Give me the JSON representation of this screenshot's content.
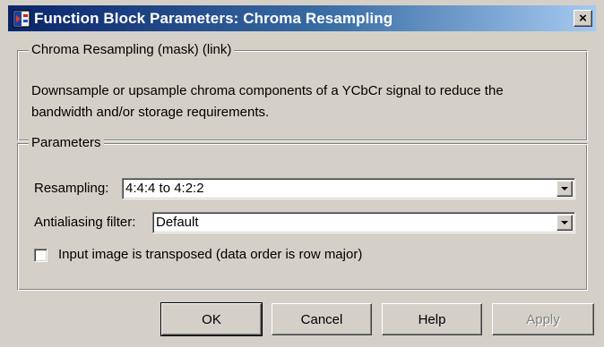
{
  "window": {
    "title": "Function Block Parameters: Chroma Resampling",
    "close_glyph": "×"
  },
  "description_group": {
    "legend": "Chroma Resampling (mask) (link)",
    "lines": [
      "Downsample or upsample chroma components of a YCbCr signal to reduce the",
      "bandwidth and/or storage requirements."
    ]
  },
  "parameters_group": {
    "legend": "Parameters",
    "resampling": {
      "label": "Resampling:",
      "value": "4:4:4 to 4:2:2"
    },
    "antialiasing": {
      "label": "Antialiasing filter:",
      "value": "Default"
    },
    "transposed": {
      "label": "Input image is transposed (data order is row major)",
      "checked": false
    }
  },
  "buttons": {
    "ok": "OK",
    "cancel": "Cancel",
    "help": "Help",
    "apply": "Apply"
  },
  "colors": {
    "title_start": "#0a246a",
    "title_end": "#a6caf0",
    "face": "#d4d0c8"
  },
  "icons": {
    "window_icon": "simulink-block-icon",
    "close": "close-icon",
    "dropdown": "chevron-down-icon"
  }
}
